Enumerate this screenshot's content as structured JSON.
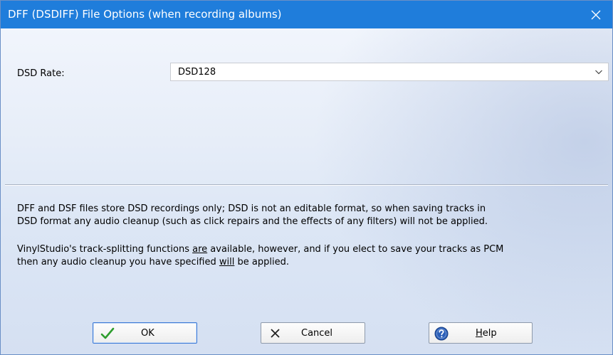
{
  "window": {
    "title": "DFF (DSDIFF) File Options (when recording albums)",
    "title_bar_color": "#1f7ddb"
  },
  "form": {
    "dsd_rate_label": "DSD Rate:",
    "dsd_rate_value": "DSD128"
  },
  "info": {
    "p1_line1": "DFF and DSF files store DSD recordings only; DSD is not an editable format, so when saving tracks in",
    "p1_line2": "DSD format any audio cleanup (such as click repairs and the effects of any filters) will not be applied.",
    "p2_a": "VinylStudio's track-splitting functions ",
    "p2_are": "are",
    "p2_b": " available, however, and if you elect to save your tracks as PCM",
    "p2_c": "then any audio cleanup you have specified ",
    "p2_will": "will",
    "p2_d": " be applied."
  },
  "buttons": {
    "ok": "OK",
    "cancel": "Cancel",
    "help_first": "H",
    "help_rest": "elp"
  },
  "icons": {
    "close": "close-icon",
    "dropdown": "chevron-down-icon",
    "ok": "checkmark-icon",
    "cancel": "x-icon",
    "help": "help-question-icon"
  },
  "colors": {
    "ok_check": "#2e9d2e",
    "help_circle": "#2b5fb8",
    "default_button_border": "#3b79d6"
  }
}
